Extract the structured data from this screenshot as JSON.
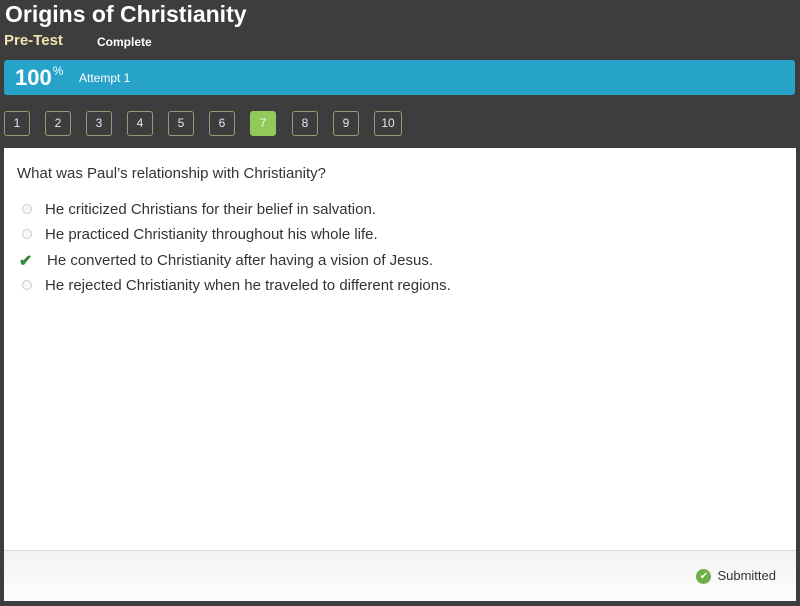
{
  "header": {
    "title": "Origins of Christianity",
    "subtitle": "Pre-Test",
    "status": "Complete"
  },
  "score": {
    "value": "100",
    "unit": "%",
    "attempt": "Attempt 1"
  },
  "question_nav": {
    "items": [
      "1",
      "2",
      "3",
      "4",
      "5",
      "6",
      "7",
      "8",
      "9",
      "10"
    ],
    "active": "7"
  },
  "question": {
    "text": "What was Paul’s relationship with Christianity?",
    "options": [
      {
        "text": "He criticized Christians for their belief in salvation.",
        "selected": false
      },
      {
        "text": "He practiced Christianity throughout his whole life.",
        "selected": false
      },
      {
        "text": "He converted to Christianity after having a vision of Jesus.",
        "selected": true
      },
      {
        "text": "He rejected Christianity when he traveled to different regions.",
        "selected": false
      }
    ]
  },
  "footer": {
    "status_label": "Submitted",
    "status_icon": "check-circle-icon"
  },
  "colors": {
    "background": "#3d3d3d",
    "score_bar": "#27a3c9",
    "active_nav": "#93c95b",
    "check": "#2e8b3a",
    "submitted_icon": "#6fb04a"
  }
}
